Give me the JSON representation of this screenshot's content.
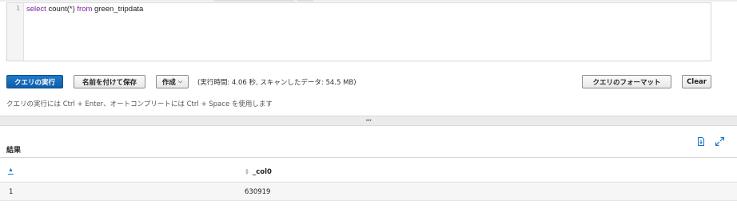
{
  "editor": {
    "line_number": "1",
    "code_keyword_select": "select",
    "code_func": " count(*) ",
    "code_keyword_from": "from",
    "code_table": " green_tripdata"
  },
  "toolbar": {
    "run_label": "クエリの実行",
    "save_as_label": "名前を付けて保存",
    "create_label": "作成",
    "exec_info": "(実行時間: 4.06 秒, スキャンしたデータ: 54.5 MB)",
    "format_label": "クエリのフォーマット",
    "clear_label": "Clear"
  },
  "hint": "クエリの実行には Ctrl + Enter、オートコンプリートには Ctrl + Space を使用します",
  "results": {
    "title": "結果",
    "columns": [
      "",
      "_col0"
    ],
    "rows": [
      [
        "1",
        "630919"
      ]
    ]
  },
  "icons": {
    "download": "download-file-icon",
    "expand": "expand-icon",
    "splitter": "drag-handle-icon"
  },
  "colors": {
    "primary": "#1f79c8",
    "keyword": "#7b1fa2",
    "link": "#1a73c8"
  }
}
